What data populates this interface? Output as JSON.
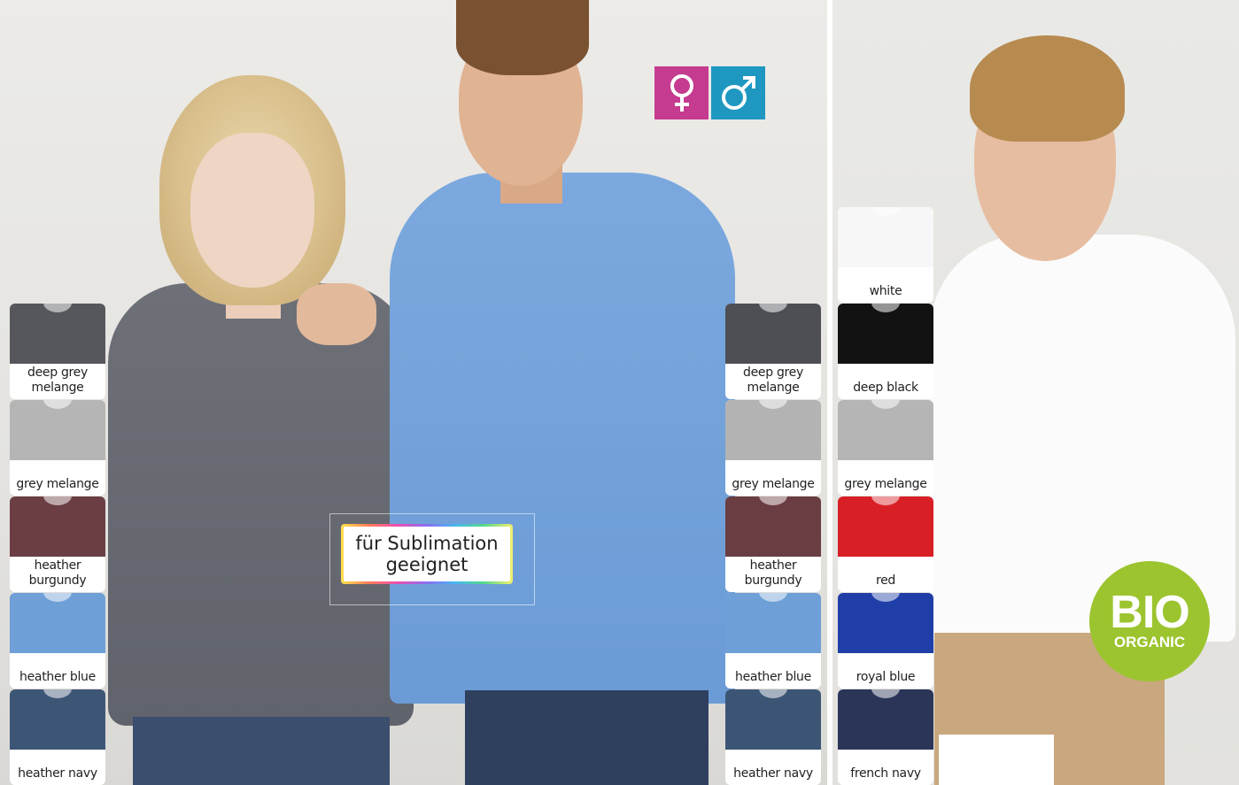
{
  "sublimation_badge": {
    "line1": "für Sublimation",
    "line2": "geeignet"
  },
  "bio_badge": {
    "line1": "BIO",
    "line2": "ORGANIC"
  },
  "gender_icons": {
    "female_symbol": "♀",
    "male_symbol": "♂",
    "female_color": "#c53b8f",
    "male_color": "#1e97c1"
  },
  "women_swatches": [
    {
      "label": "deep grey melange",
      "color": "#55575c"
    },
    {
      "label": "grey melange",
      "color": "#b5b5b5"
    },
    {
      "label": "heather burgundy",
      "color": "#6b3e43"
    },
    {
      "label": "heather blue",
      "color": "#6e9fd6"
    },
    {
      "label": "heather navy",
      "color": "#3e5676"
    }
  ],
  "men_swatches": [
    {
      "label": "deep grey melange",
      "color": "#4d4f54"
    },
    {
      "label": "grey melange",
      "color": "#b3b3b3"
    },
    {
      "label": "heather burgundy",
      "color": "#6a3d42"
    },
    {
      "label": "heather blue",
      "color": "#6e9fd6"
    },
    {
      "label": "heather navy",
      "color": "#3d5574"
    }
  ],
  "organic_swatches": [
    {
      "label": "white",
      "color": "#f7f7f7"
    },
    {
      "label": "deep black",
      "color": "#121212"
    },
    {
      "label": "grey melange",
      "color": "#b5b5b5"
    },
    {
      "label": "red",
      "color": "#d91f26"
    },
    {
      "label": "royal blue",
      "color": "#1f3ea8"
    },
    {
      "label": "french navy",
      "color": "#2a3558"
    }
  ]
}
